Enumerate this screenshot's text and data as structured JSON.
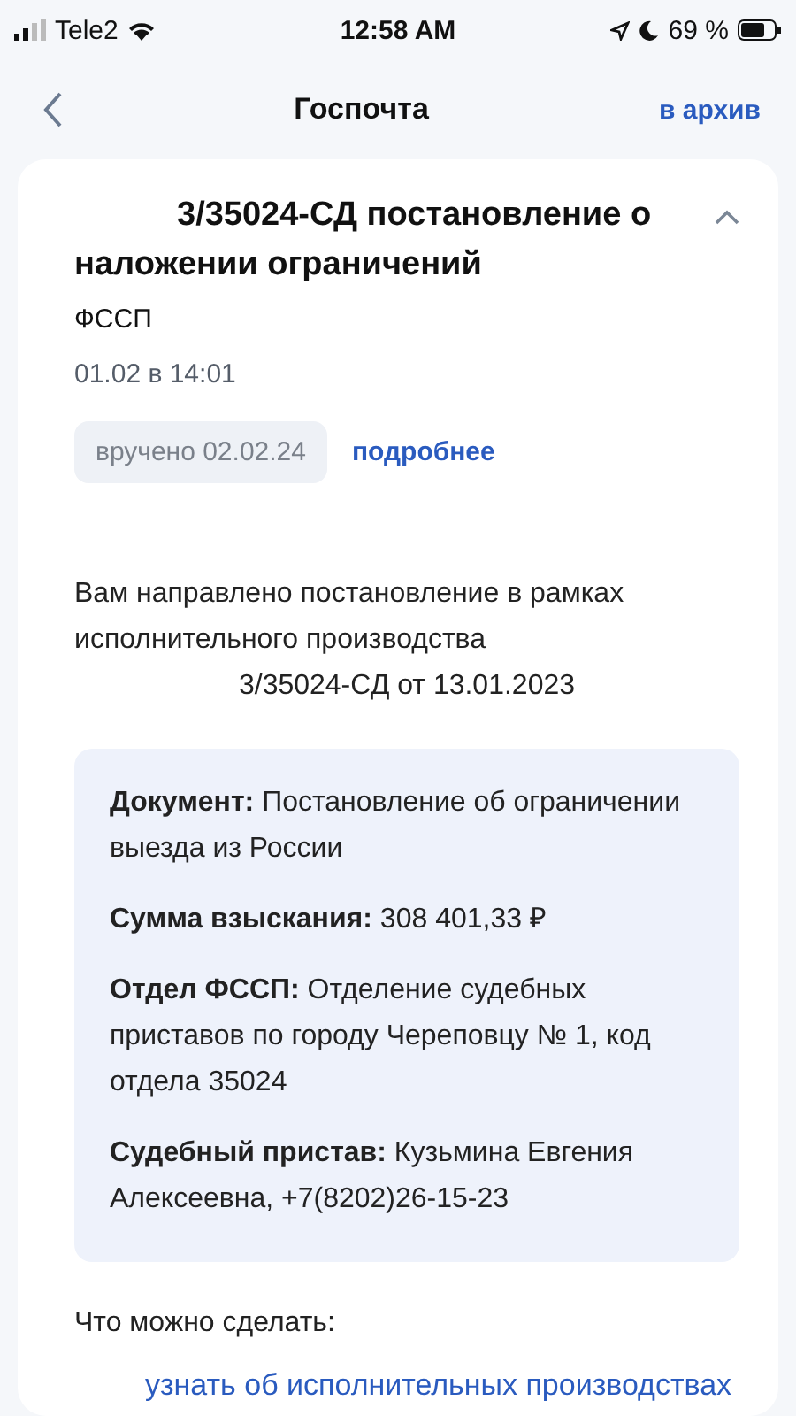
{
  "status_bar": {
    "carrier": "Tele2",
    "time": "12:58 AM",
    "battery": "69 %"
  },
  "header": {
    "title": "Госпочта",
    "action": "в архив"
  },
  "message": {
    "title": "3/35024-СД постановление о наложении ограничений",
    "expanded": true,
    "sender": "ФССП",
    "date": "01.02 в 14:01",
    "delivered": "вручено 02.02.24",
    "details_link": "подробнее",
    "intro": [
      "Вам направлено постановление в рамках исполнительного производства",
      "3/35024-СД от 13.01.2023"
    ],
    "fields": [
      {
        "label": "Документ:",
        "value": "Постановление об ограничении выезда из России"
      },
      {
        "label": "Сумма взыскания:",
        "value": "308 401,33 ₽"
      },
      {
        "label": "Отдел ФССП:",
        "value": "Отделение судебных приставов по городу Череповцу № 1, код отдела 35024"
      },
      {
        "label": "Судебный пристав:",
        "value": "Кузьмина Евгения Алексеевна, +7(8202)26-15-23"
      }
    ],
    "actions_title": "Что можно сделать:",
    "actions": [
      "узнать об исполнительных производствах"
    ]
  }
}
